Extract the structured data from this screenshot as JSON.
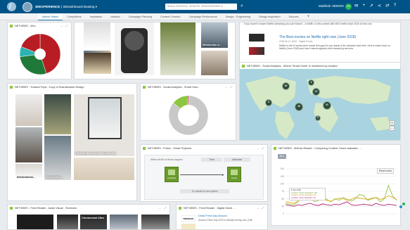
{
  "header": {
    "app_name": "3DEXPERIENCE",
    "dashboard": "| 3DDashboard",
    "dashboard_name": "Beating ▾",
    "search_placeholder": "Search 3DSPACE, 3DSwYM, 3DDASHBOARD & ...",
    "user_name": "Mathilde HEMON",
    "user_badge": "DS"
  },
  "tabs": [
    {
      "label": "Market Watch",
      "active": true
    },
    {
      "label": "Competitors"
    },
    {
      "label": "Inspiration"
    },
    {
      "label": "Ideation"
    },
    {
      "label": "Campaign Planning"
    },
    {
      "label": "Content Creation"
    },
    {
      "label": "Campaign Performance"
    },
    {
      "label": "Design - Engineering"
    },
    {
      "label": "Design Inspiration"
    },
    {
      "label": "Sources"
    },
    {
      "label": "+"
    }
  ],
  "widgets": {
    "w1": {
      "title": "NETVIBES - Wor..."
    },
    "w2": {
      "title": ""
    },
    "w3": {
      "title": ""
    },
    "w4": {
      "title": "NETVIBES - Tracked Topic : Copy of Scandinavian Design"
    },
    "w5": {
      "title": "NETVIBES - Social Analytics - Smart Hom..."
    },
    "w6": {
      "title": "NETVIBES - Social Analytics - Where 'Smart Home' is mentioned by location"
    },
    "w7": {
      "title": "NETVIBES - Potion - Smart Projector"
    },
    "w8": {
      "title": "NETVIBES - Metrics Reader - Comparing Content: Home assistant, ..."
    },
    "w9": {
      "title": "NETVIBES - Feed Reader - Audio Visual - Technolor"
    },
    "w10": {
      "title": "NETVIBES - Feed Reader - Digital Home ..."
    }
  },
  "image_tiles": {
    "best": "The best w...",
    "wimbledon": "Wimnledon a...",
    "interior": "Interiordesin...",
    "world": "The World's ...",
    "diy": "DIYBeaute fravnhel: Modern #5..."
  },
  "feed": {
    "top_text": "If you haven't chosen Netflix streaming you can't blame... a Netflix, is this content with NEO netflix since 2016 to best one.",
    "item_title": "The Best movies on Netflix right now (June 2018)",
    "item_meta": "2018-06-14 18:00 - Digital Trends",
    "item_text": "Netflix is full of movies from manic feel-good to top drama & the absolute best bets. Here's what's best on Netflix (June 2018) and how it stacks against other streaming services."
  },
  "potion": {
    "question": "What will all of those happen",
    "tab_then": "Then",
    "tab_alternate": "Alternate",
    "box1_label": "Available",
    "box2_label": "Smart",
    "button": "Try rebuild on new options"
  },
  "metrics": {
    "badge": "ALL",
    "reset": "Reset zoom",
    "legend_date": "8 Jan 2018",
    "legend_1": "Content: Smart assistant: 129",
    "legend_2": "Content: Home assistant: 44",
    "legend_3": "Content: Voice assistant: 31"
  },
  "feed2": {
    "brand": "amazon",
    "line1": "Deals Prime Day Amazon",
    "line2": "Amazon Prime Day 2018 is officially ending soon (13th",
    "chromecast": "Chromecast Ultra"
  },
  "map": {
    "clusters": [
      "4",
      "26",
      "12",
      "5",
      "39",
      "31",
      "2"
    ]
  },
  "chart_data": [
    {
      "type": "pie",
      "title": "",
      "slices": [
        {
          "value": 45,
          "color": "#b81d24"
        },
        {
          "value": 28,
          "color": "#1f7a3a"
        },
        {
          "value": 8,
          "color": "#2bb3b3"
        },
        {
          "value": 19,
          "color": "#b81d24"
        }
      ]
    },
    {
      "type": "pie",
      "title": "",
      "slices": [
        {
          "value": 86,
          "color": "#c8c8c8"
        },
        {
          "value": 13,
          "color": "#8dc63f"
        },
        {
          "value": 1,
          "color": "#b81d24"
        }
      ]
    },
    {
      "type": "line",
      "title": "",
      "ylim": [
        0,
        150
      ],
      "yticks": [
        150,
        125,
        100,
        75,
        50,
        25,
        0
      ],
      "x": [
        0,
        1,
        2,
        3,
        4,
        5,
        6,
        7,
        8,
        9,
        10,
        11,
        12,
        13,
        14,
        15,
        16,
        17,
        18,
        19,
        20,
        21,
        22,
        23,
        24,
        25,
        26,
        27
      ],
      "xticks": [
        "",
        "",
        "",
        ""
      ],
      "series": [
        {
          "color": "#8dc63f",
          "values": [
            35,
            32,
            30,
            40,
            70,
            85,
            55,
            40,
            45,
            60,
            48,
            40,
            50,
            45,
            55,
            48,
            42,
            50,
            65,
            60,
            45,
            50,
            55,
            40,
            50,
            95,
            60,
            45
          ]
        },
        {
          "color": "#e6a817",
          "values": [
            40,
            38,
            35,
            42,
            55,
            60,
            48,
            45,
            50,
            52,
            45,
            42,
            48,
            52,
            50,
            45,
            48,
            55,
            52,
            50,
            48,
            52,
            55,
            48,
            52,
            60,
            55,
            48
          ]
        },
        {
          "color": "#b01e6e",
          "values": [
            30,
            28,
            25,
            30,
            28,
            32,
            35,
            30,
            28,
            33,
            30,
            28,
            32,
            30,
            35,
            40,
            30,
            28,
            30,
            32,
            30,
            28,
            35,
            30,
            28,
            32,
            30,
            28
          ]
        }
      ]
    }
  ]
}
